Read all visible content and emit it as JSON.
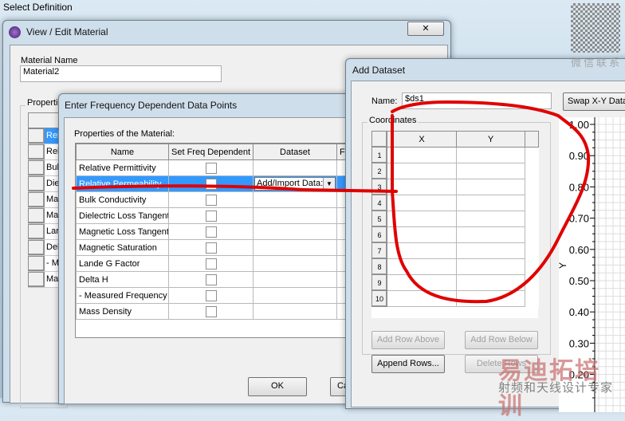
{
  "background_window": {
    "title": "Select Definition"
  },
  "material_window": {
    "title": "View / Edit Material",
    "material_name_label": "Material Name",
    "material_name_value": "Material2",
    "properties_label": "Properties",
    "row_stubs": [
      "Rel",
      "Rel",
      "Bul",
      "Die",
      "Ma",
      "Ma",
      "Lar",
      "Del",
      "- M",
      "Ma"
    ]
  },
  "freq_dialog": {
    "title": "Enter Frequency Dependent Data Points",
    "properties_label": "Properties of the Material:",
    "columns": [
      "Name",
      "Set Freq Dependent",
      "Dataset",
      "F"
    ],
    "rows": [
      {
        "name": "Relative Permittivity",
        "checked": false,
        "dataset": ""
      },
      {
        "name": "Relative Permeability",
        "checked": true,
        "dataset": "Add/Import Data:"
      },
      {
        "name": "Bulk Conductivity",
        "checked": false,
        "dataset": ""
      },
      {
        "name": "Dielectric Loss Tangent",
        "checked": false,
        "dataset": ""
      },
      {
        "name": "Magnetic Loss Tangent",
        "checked": false,
        "dataset": ""
      },
      {
        "name": "Magnetic Saturation",
        "checked": false,
        "dataset": ""
      },
      {
        "name": "Lande G Factor",
        "checked": false,
        "dataset": ""
      },
      {
        "name": "Delta H",
        "checked": false,
        "dataset": ""
      },
      {
        "name": "-  Measured Frequency",
        "checked": false,
        "dataset": ""
      },
      {
        "name": "Mass Density",
        "checked": false,
        "dataset": ""
      }
    ],
    "ok_label": "OK",
    "cancel_label": "Ca"
  },
  "add_dataset": {
    "title": "Add Dataset",
    "name_label": "Name:",
    "name_value": "$ds1",
    "swap_label": "Swap X-Y Data",
    "coordinates_label": "Coordinates",
    "columns": [
      "X",
      "Y"
    ],
    "row_numbers": [
      "1",
      "2",
      "3",
      "4",
      "5",
      "6",
      "7",
      "8",
      "9",
      "10"
    ],
    "add_row_above": "Add Row Above",
    "add_row_below": "Add Row Below",
    "append_rows": "Append Rows...",
    "delete_rows": "Delete Rows"
  },
  "chart_data": {
    "type": "line",
    "ylabel": "Y",
    "yticks": [
      "1.00",
      "0.90",
      "0.80",
      "0.70",
      "0.60",
      "0.50",
      "0.40",
      "0.30",
      "0.20"
    ],
    "ylim": [
      0.2,
      1.0
    ],
    "series": []
  },
  "watermark": {
    "qr_caption": "微信联系",
    "brand": "易迪拓培训",
    "slogan": "射频和天线设计专家"
  },
  "colors": {
    "selection": "#3399ff",
    "annotation": "#e00000"
  }
}
